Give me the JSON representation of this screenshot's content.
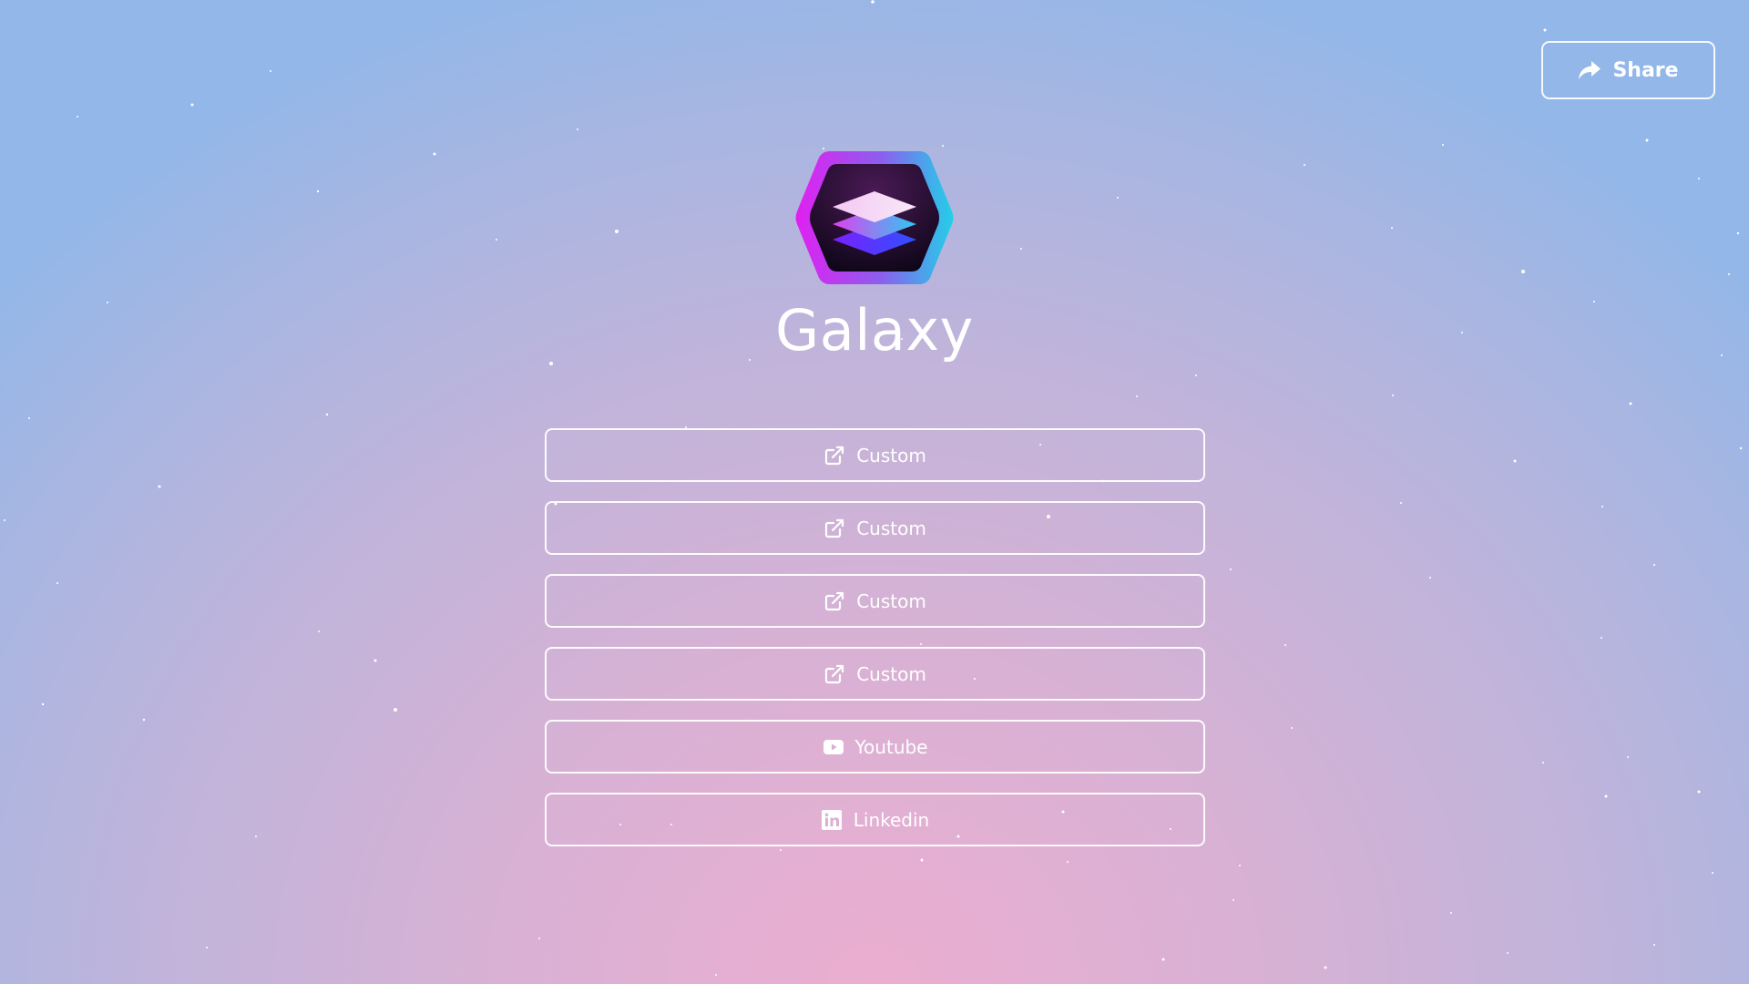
{
  "header": {
    "share_label": "Share",
    "share_icon": "share-arrow-icon"
  },
  "profile": {
    "title": "Galaxy",
    "logo": "layers-hexagon-logo"
  },
  "links": [
    {
      "label": "Custom",
      "icon": "external-link-icon"
    },
    {
      "label": "Custom",
      "icon": "external-link-icon"
    },
    {
      "label": "Custom",
      "icon": "external-link-icon"
    },
    {
      "label": "Custom",
      "icon": "external-link-icon"
    },
    {
      "label": "Youtube",
      "icon": "youtube-icon"
    },
    {
      "label": "Linkedin",
      "icon": "linkedin-icon"
    }
  ],
  "colors": {
    "background_top": "#92b7e8",
    "background_center": "#ebaed0",
    "button_border": "#ffffff",
    "logo_gradient_start": "#e020f0",
    "logo_gradient_end": "#22d0e8",
    "logo_inner": "#1a0a2a"
  }
}
